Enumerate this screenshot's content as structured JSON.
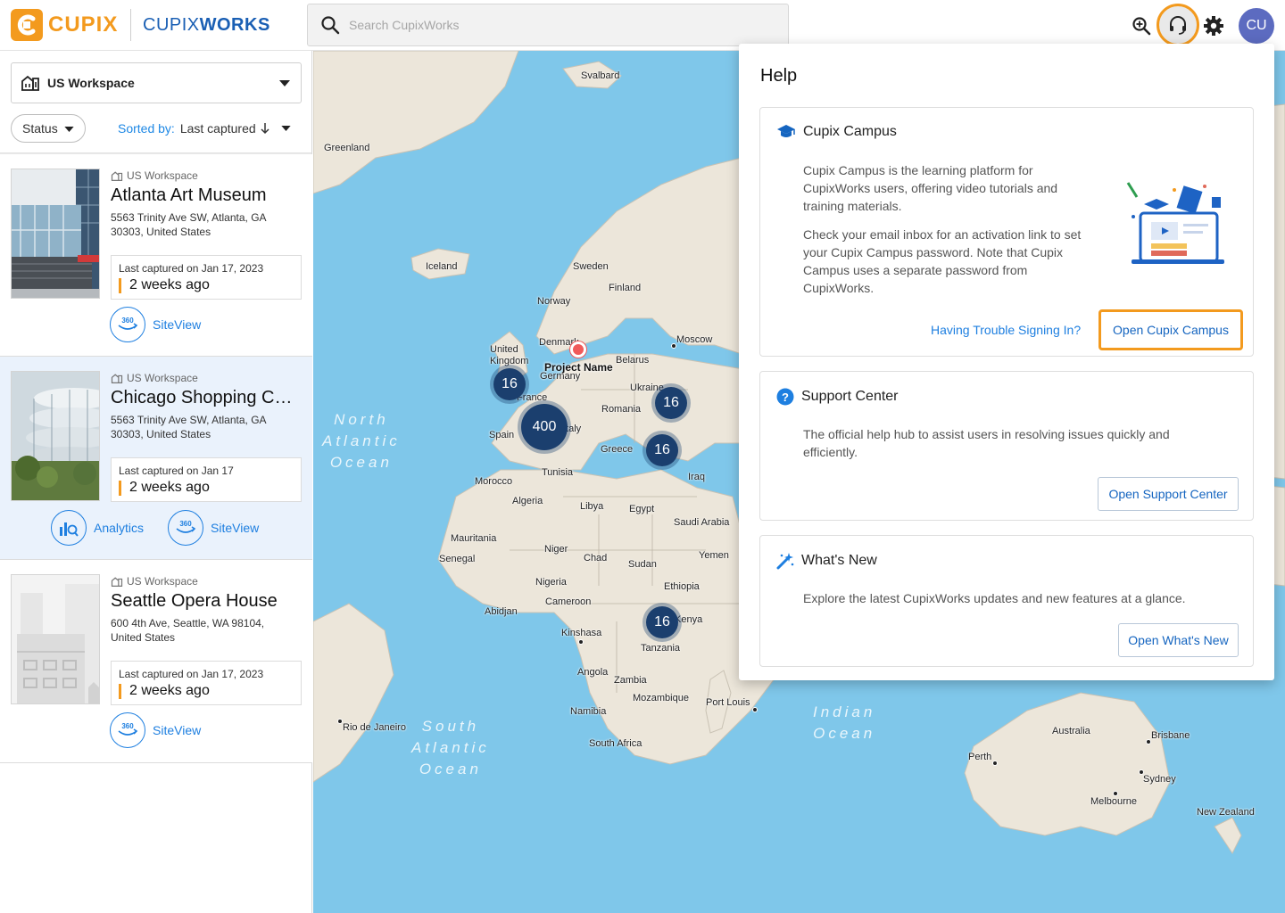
{
  "brand": {
    "logo_text": "CUPIX",
    "product_light": "CUPIX",
    "product_bold": "WORKS",
    "accent": "#f39a1e",
    "blue": "#1a5fb4"
  },
  "search": {
    "placeholder": "Search CupixWorks",
    "value": ""
  },
  "header_icons": [
    "zoom-search-icon",
    "help-headset-icon",
    "gear-icon"
  ],
  "user": {
    "initials": "CU"
  },
  "sidebar": {
    "workspace": "US Workspace",
    "status_label": "Status",
    "sort_prefix": "Sorted by:",
    "sort_value": "Last captured"
  },
  "projects": [
    {
      "workspace": "US Workspace",
      "title": "Atlanta Art Museum",
      "address": "5563 Trinity Ave SW, Atlanta, GA 30303, United States",
      "captured": "Last captured on Jan 17, 2023",
      "ago": "2 weeks ago",
      "actions": [
        "SiteView"
      ]
    },
    {
      "workspace": "US Workspace",
      "title": "Chicago Shopping Center",
      "address": "5563 Trinity Ave SW, Atlanta, GA 30303, United States",
      "captured": "Last captured on Jan 17",
      "ago": "2 weeks ago",
      "actions": [
        "Analytics",
        "SiteView"
      ]
    },
    {
      "workspace": "US Workspace",
      "title": "Seattle Opera House",
      "address": "600 4th Ave, Seattle, WA 98104, United States",
      "captured": "Last captured on Jan 17, 2023",
      "ago": "2 weeks ago",
      "actions": [
        "SiteView"
      ]
    }
  ],
  "map": {
    "pin_label": "Project Name",
    "clusters": [
      "16",
      "400",
      "16",
      "16",
      "16"
    ],
    "oceans": [
      "North Atlantic Ocean",
      "South Atlantic Ocean",
      "Indian Ocean"
    ],
    "places": [
      "Svalbard",
      "Greenland",
      "Iceland",
      "Sweden",
      "Finland",
      "Norway",
      "United Kingdom",
      "Denmark",
      "Moscow",
      "Belarus",
      "Germany",
      "France",
      "Ukraine",
      "Romania",
      "Spain",
      "Italy",
      "Greece",
      "Tunisia",
      "Morocco",
      "Iraq",
      "Algeria",
      "Libya",
      "Egypt",
      "Saudi Arabia",
      "Mauritania",
      "Senegal",
      "Niger",
      "Chad",
      "Sudan",
      "Yemen",
      "Nigeria",
      "Ethiopia",
      "Cameroon",
      "Abidjan",
      "Kenya",
      "Kinshasa",
      "Tanzania",
      "Angola",
      "Zambia",
      "Mozambique",
      "Namibia",
      "Port Louis",
      "South Africa",
      "Rio de Janeiro",
      "Australia",
      "Brisbane",
      "Perth",
      "Sydney",
      "Melbourne",
      "New Zealand"
    ]
  },
  "help": {
    "title": "Help",
    "campus": {
      "heading": "Cupix Campus",
      "p1": "Cupix Campus is the learning platform for CupixWorks users, offering video tutorials and training materials.",
      "p2": "Check your email inbox for an activation link to set your Cupix Campus password. Note that Cupix Campus uses a separate password from CupixWorks.",
      "link": "Having Trouble Signing In?",
      "button": "Open Cupix Campus"
    },
    "support": {
      "heading": "Support Center",
      "p": "The official help hub to assist users in resolving issues quickly and efficiently.",
      "button": "Open Support Center"
    },
    "whatsnew": {
      "heading": "What's New",
      "p": "Explore the latest CupixWorks updates and new features at a glance.",
      "button": "Open What's New"
    }
  }
}
